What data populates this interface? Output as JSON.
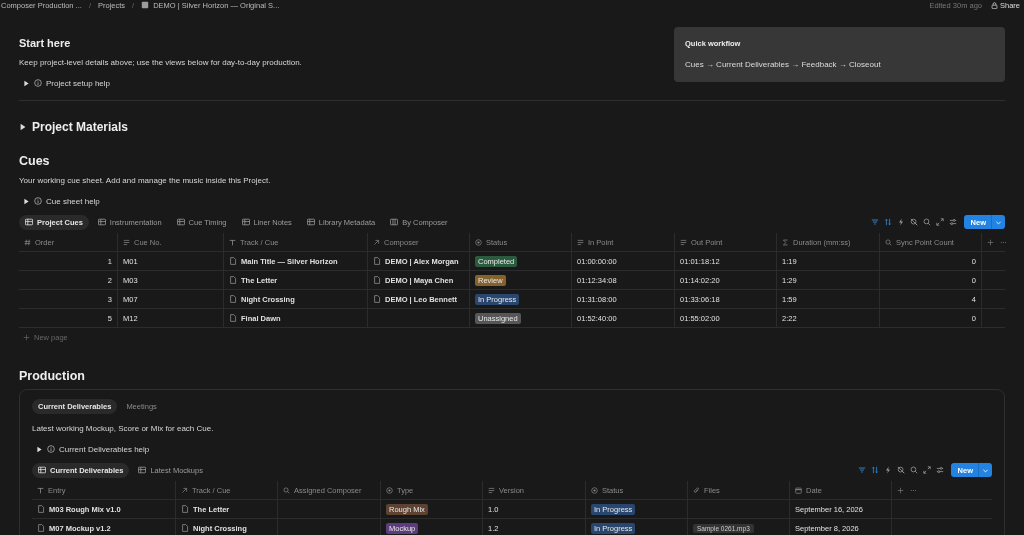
{
  "topbar": {
    "breadcrumbs": [
      "Composer Production ...",
      "Projects",
      "DEMO | Silver Horizon — Original S..."
    ],
    "separator": "/",
    "edited": "Edited 30m ago",
    "share": "Share"
  },
  "start": {
    "title": "Start here",
    "text": "Keep project-level details above; use the views below for day-to-day production.",
    "toggle": {
      "label": "Project setup help",
      "expanded": false
    }
  },
  "callout": {
    "title": "Quick workflow",
    "text": "Cues → Current Deliverables → Feedback → Closeout"
  },
  "materials": {
    "title": "Project Materials",
    "expanded": false
  },
  "cues": {
    "title": "Cues",
    "text": "Your working cue sheet. Add and manage the music inside this Project.",
    "toggle": {
      "label": "Cue sheet help",
      "expanded": false
    },
    "views": [
      {
        "label": "Project Cues",
        "kind": "table",
        "selected": true
      },
      {
        "label": "Instrumentation",
        "kind": "table",
        "selected": false
      },
      {
        "label": "Cue Timing",
        "kind": "table",
        "selected": false
      },
      {
        "label": "Liner Notes",
        "kind": "table",
        "selected": false
      },
      {
        "label": "Library Metadata",
        "kind": "table",
        "selected": false
      },
      {
        "label": "By Composer",
        "kind": "board",
        "selected": false
      }
    ],
    "toolbar": {
      "filter_active": true,
      "sort_active": true,
      "new_button": "New"
    },
    "table": {
      "columns": [
        {
          "label": "Order",
          "kind": "number"
        },
        {
          "label": "Cue No.",
          "kind": "text"
        },
        {
          "label": "Track / Cue",
          "kind": "title"
        },
        {
          "label": "Composer",
          "kind": "relation"
        },
        {
          "label": "Status",
          "kind": "status"
        },
        {
          "label": "In Point",
          "kind": "text"
        },
        {
          "label": "Out Point",
          "kind": "text"
        },
        {
          "label": "Duration (mm:ss)",
          "kind": "formula"
        },
        {
          "label": "Sync Point Count",
          "kind": "rollup"
        }
      ],
      "rows": [
        {
          "cells": [
            "1",
            "M01",
            "Main Title — Silver Horizon",
            "DEMO | Alex Morgan",
            {
              "text": "Completed",
              "color": "#2b5b3e"
            },
            "01:00:00:00",
            "01:01:18:12",
            "1:19",
            "0"
          ]
        },
        {
          "cells": [
            "2",
            "M03",
            "The Letter",
            "DEMO | Maya Chen",
            {
              "text": "Review",
              "color": "#86622a"
            },
            "01:12:34:08",
            "01:14:02:20",
            "1:29",
            "0"
          ]
        },
        {
          "cells": [
            "3",
            "M07",
            "Night Crossing",
            "DEMO | Leo Bennett",
            {
              "text": "In Progress",
              "color": "#28466e"
            },
            "01:31:08:00",
            "01:33:06:18",
            "1:59",
            "4"
          ]
        },
        {
          "cells": [
            "5",
            "M12",
            "Final Dawn",
            null,
            {
              "text": "Unassigned",
              "color": "#565656"
            },
            "01:52:40:00",
            "01:55:02:00",
            "2:22",
            "0"
          ]
        }
      ],
      "new_page": "New page"
    }
  },
  "production": {
    "title": "Production",
    "tabs": [
      {
        "label": "Current Deliverables",
        "selected": true
      },
      {
        "label": "Meetings",
        "selected": false
      }
    ],
    "text": "Latest working Mockup, Score or Mix for each Cue.",
    "toggle": {
      "label": "Current Deliverables help",
      "expanded": false
    },
    "views": [
      {
        "label": "Current Deliverables",
        "kind": "table",
        "selected": true
      },
      {
        "label": "Latest Mockups",
        "kind": "table",
        "selected": false
      }
    ],
    "toolbar": {
      "filter_active": true,
      "sort_active": true,
      "new_button": "New"
    },
    "table": {
      "columns": [
        {
          "label": "Entry",
          "kind": "title"
        },
        {
          "label": "Track / Cue",
          "kind": "relation"
        },
        {
          "label": "Assigned Composer",
          "kind": "rollup"
        },
        {
          "label": "Type",
          "kind": "select"
        },
        {
          "label": "Version",
          "kind": "text"
        },
        {
          "label": "Status",
          "kind": "status"
        },
        {
          "label": "Files",
          "kind": "files"
        },
        {
          "label": "Date",
          "kind": "date"
        }
      ],
      "rows": [
        {
          "cells": [
            "M03 Rough Mix v1.0",
            "The Letter",
            null,
            {
              "text": "Rough Mix",
              "color": "#5d4131"
            },
            "1.0",
            {
              "text": "In Progress",
              "color": "#28466e"
            },
            null,
            "September 16, 2026"
          ]
        },
        {
          "cells": [
            "M07 Mockup v1.2",
            "Night Crossing",
            null,
            {
              "text": "Mockup",
              "color": "#5b3c7c"
            },
            "1.2",
            {
              "text": "In Progress",
              "color": "#28466e"
            },
            "Sample 0261.mp3",
            "September 8, 2026"
          ]
        }
      ]
    }
  }
}
